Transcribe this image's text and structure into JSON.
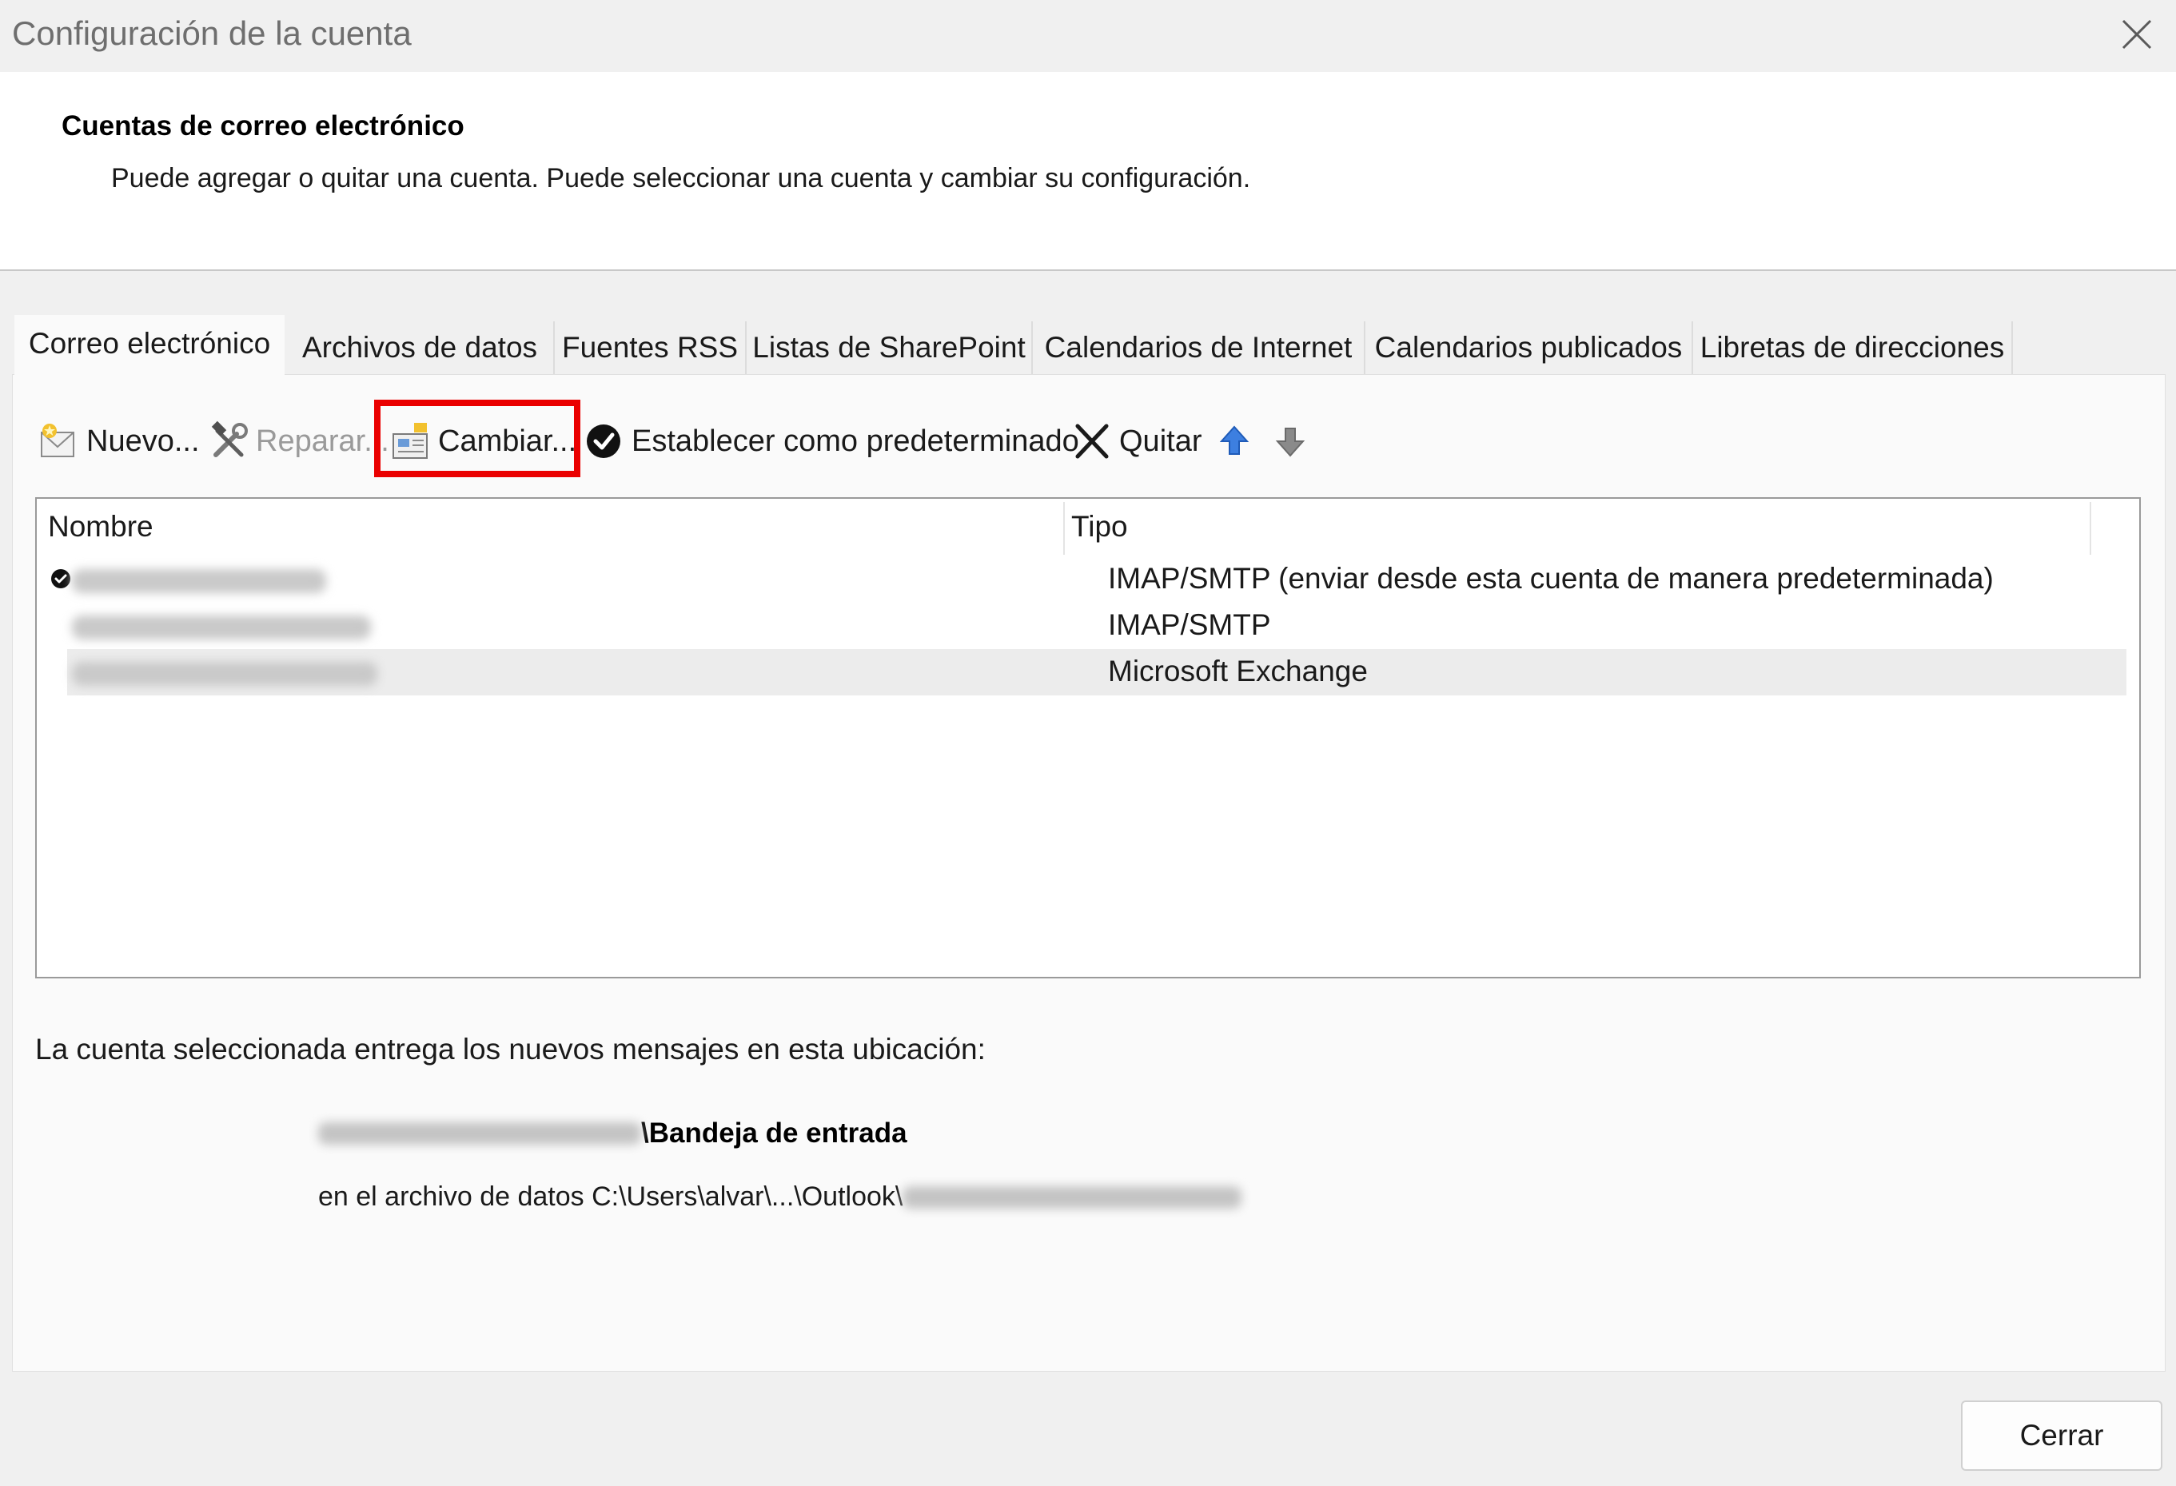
{
  "window": {
    "title": "Configuración de la cuenta"
  },
  "header": {
    "title": "Cuentas de correo electrónico",
    "description": "Puede agregar o quitar una cuenta. Puede seleccionar una cuenta y cambiar su configuración."
  },
  "tabs": [
    {
      "label": "Correo electrónico",
      "active": true
    },
    {
      "label": "Archivos de datos"
    },
    {
      "label": "Fuentes RSS"
    },
    {
      "label": "Listas de SharePoint"
    },
    {
      "label": "Calendarios de Internet"
    },
    {
      "label": "Calendarios publicados"
    },
    {
      "label": "Libretas de direcciones"
    }
  ],
  "toolbar": {
    "new_label": "Nuevo...",
    "repair_label": "Reparar...",
    "change_label": "Cambiar...",
    "set_default_label": "Establecer como predeterminado",
    "remove_label": "Quitar",
    "highlight_color": "#ea0000"
  },
  "accounts_list": {
    "columns": [
      "Nombre",
      "Tipo"
    ],
    "rows": [
      {
        "type": "IMAP/SMTP (enviar desde esta cuenta de manera predeterminada)",
        "default": true
      },
      {
        "type": "IMAP/SMTP"
      },
      {
        "type": "Microsoft Exchange",
        "selected": true
      }
    ]
  },
  "delivery": {
    "label": "La cuenta seleccionada entrega los nuevos mensajes en esta ubicación:",
    "folder": "\\Bandeja de entrada",
    "path_prefix": "en el archivo de datos C:\\Users\\alvar\\...\\Outlook\\"
  },
  "footer": {
    "close_label": "Cerrar"
  }
}
